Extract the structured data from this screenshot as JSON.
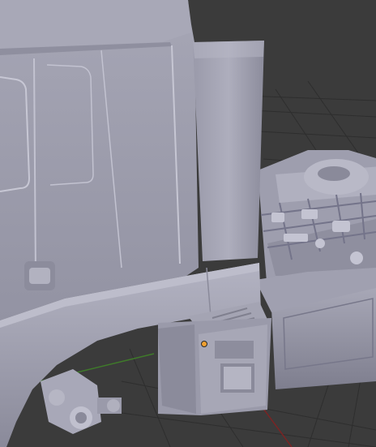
{
  "viewport": {
    "background": "#3b3b3b",
    "grid_color": "#2e2e2e",
    "axis_x_color": "#7a2424",
    "axis_y_color": "#3f7a2a",
    "model_color": "#a3a3b3",
    "origin_color": "#f0a030",
    "object": "truck-cab-model"
  }
}
